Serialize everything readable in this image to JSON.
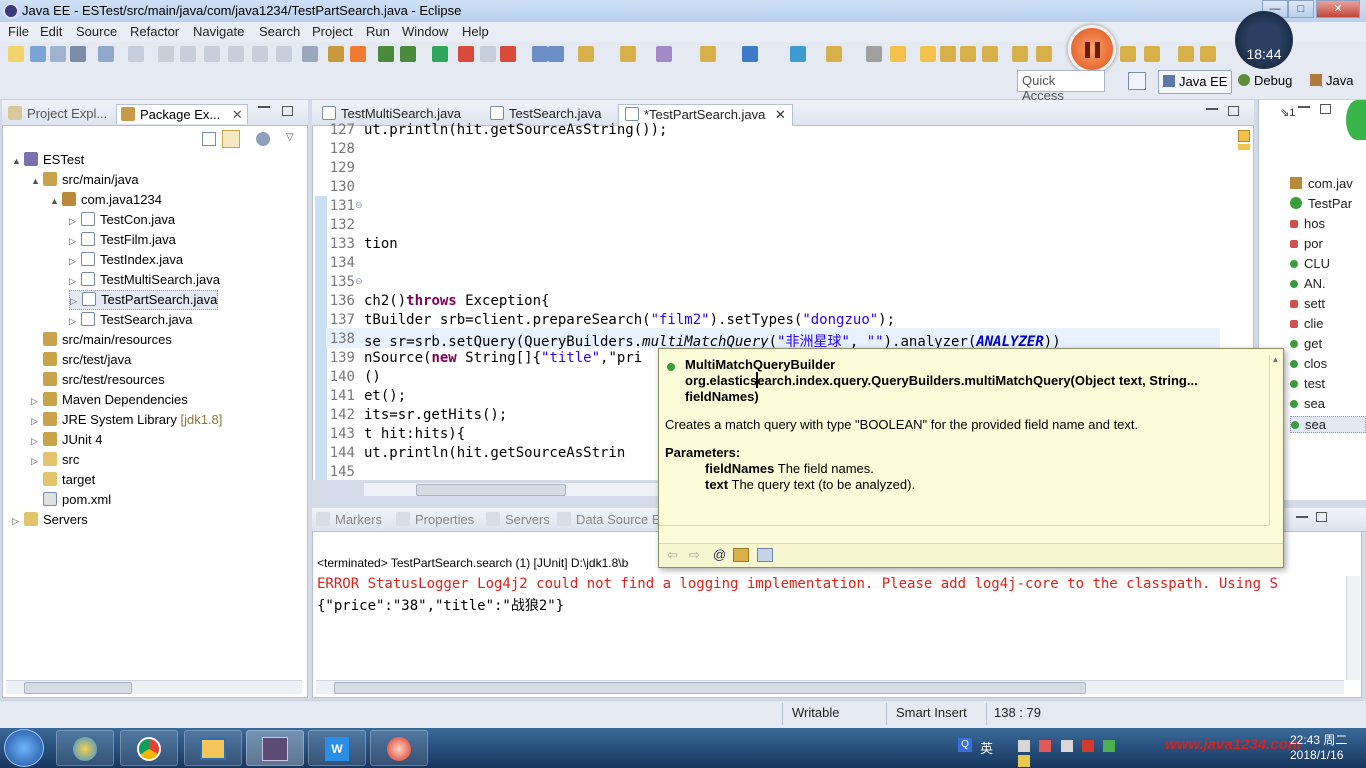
{
  "window": {
    "title": "Java EE - ESTest/src/main/java/com/java1234/TestPartSearch.java - Eclipse",
    "min_label": "—",
    "max_label": "□",
    "close_label": "✕"
  },
  "menu": [
    "File",
    "Edit",
    "Source",
    "Refactor",
    "Navigate",
    "Search",
    "Project",
    "Run",
    "Window",
    "Help"
  ],
  "toolbar": {
    "quick_access_placeholder": "Quick Access",
    "perspectives": [
      "Java EE",
      "Debug",
      "Java"
    ]
  },
  "recorder": {
    "clock": "18:44"
  },
  "left_panel": {
    "tabs": [
      "Project Expl...",
      "Package Ex..."
    ],
    "tree": [
      {
        "label": "ESTest",
        "level": 0,
        "twisty": "▲",
        "kind": "project"
      },
      {
        "label": "src/main/java",
        "level": 1,
        "twisty": "▲",
        "kind": "srcfolder"
      },
      {
        "label": "com.java1234",
        "level": 2,
        "twisty": "▲",
        "kind": "package"
      },
      {
        "label": "TestCon.java",
        "level": 3,
        "twisty": "▷",
        "kind": "java"
      },
      {
        "label": "TestFilm.java",
        "level": 3,
        "twisty": "▷",
        "kind": "java"
      },
      {
        "label": "TestIndex.java",
        "level": 3,
        "twisty": "▷",
        "kind": "java"
      },
      {
        "label": "TestMultiSearch.java",
        "level": 3,
        "twisty": "▷",
        "kind": "java"
      },
      {
        "label": "TestPartSearch.java",
        "level": 3,
        "twisty": "▷",
        "kind": "java",
        "selected": true
      },
      {
        "label": "TestSearch.java",
        "level": 3,
        "twisty": "▷",
        "kind": "java"
      },
      {
        "label": "src/main/resources",
        "level": 1,
        "twisty": "",
        "kind": "srcfolder"
      },
      {
        "label": "src/test/java",
        "level": 1,
        "twisty": "",
        "kind": "srcfolder"
      },
      {
        "label": "src/test/resources",
        "level": 1,
        "twisty": "",
        "kind": "srcfolder"
      },
      {
        "label": "Maven Dependencies",
        "level": 1,
        "twisty": "▷",
        "kind": "lib"
      },
      {
        "label": "JRE System Library",
        "decor": "[jdk1.8]",
        "level": 1,
        "twisty": "▷",
        "kind": "lib"
      },
      {
        "label": "JUnit 4",
        "level": 1,
        "twisty": "▷",
        "kind": "lib"
      },
      {
        "label": "src",
        "level": 1,
        "twisty": "▷",
        "kind": "folder"
      },
      {
        "label": "target",
        "level": 1,
        "twisty": "",
        "kind": "folder"
      },
      {
        "label": "pom.xml",
        "level": 1,
        "twisty": "",
        "kind": "xml"
      },
      {
        "label": "Servers",
        "level": 0,
        "twisty": "▷",
        "kind": "folder"
      }
    ]
  },
  "editor": {
    "tabs": [
      "TestMultiSearch.java",
      "TestSearch.java",
      "*TestPartSearch.java"
    ],
    "lines": [
      {
        "no": "127",
        "text": "ut.println(hit.getSourceAsString());"
      },
      {
        "no": "128",
        "text": ""
      },
      {
        "no": "129",
        "text": ""
      },
      {
        "no": "130",
        "text": ""
      },
      {
        "no": "131",
        "text": ""
      },
      {
        "no": "132",
        "text": ""
      },
      {
        "no": "133",
        "text": "tion"
      },
      {
        "no": "134",
        "text": ""
      },
      {
        "no": "135",
        "text": ""
      },
      {
        "no": "136",
        "text": "ch2()throws Exception{"
      },
      {
        "no": "137",
        "text": "tBuilder srb=client.prepareSearch(\"film2\").setTypes(\"dongzuo\");"
      },
      {
        "no": "138",
        "text": "se sr=srb.setQuery(QueryBuilders.multiMatchQuery(\"非洲星球\", \"\").analyzer(ANALYZER))"
      },
      {
        "no": "139",
        "text": "nSource(new String[]{\"title\",\"pri"
      },
      {
        "no": "140",
        "text": "()"
      },
      {
        "no": "141",
        "text": "et();"
      },
      {
        "no": "142",
        "text": "its=sr.getHits();"
      },
      {
        "no": "143",
        "text": "t hit:hits){"
      },
      {
        "no": "144",
        "text": "ut.println(hit.getSourceAsStrin"
      },
      {
        "no": "145",
        "text": ""
      }
    ]
  },
  "popup": {
    "signature": "MultiMatchQueryBuilder org.elasticsearch.index.query.QueryBuilders.multiMatchQuery(Object text, String... fieldNames)",
    "description": "Creates a match query with type \"BOOLEAN\" for the provided field name and text.",
    "params_title": "Parameters:",
    "params": [
      {
        "name": "fieldNames",
        "desc": "The field names."
      },
      {
        "name": "text",
        "desc": "The query text (to be analyzed)."
      }
    ]
  },
  "outline": {
    "items": [
      "com.jav",
      "TestPar",
      "hos",
      "por",
      "CLU",
      "AN.",
      "sett",
      "clie",
      "get",
      "clos",
      "test",
      "sea",
      "sea"
    ]
  },
  "console": {
    "tabs": [
      "Markers",
      "Properties",
      "Servers",
      "Data Source E"
    ],
    "terminated": "<terminated> TestPartSearch.search (1) [JUnit] D:\\jdk1.8\\b",
    "error": "ERROR StatusLogger Log4j2 could not find a logging implementation. Please add log4j-core to the classpath. Using S",
    "output": "{\"price\":\"38\",\"title\":\"战狼2\"}"
  },
  "status": {
    "writable": "Writable",
    "insert_mode": "Smart Insert",
    "position": "138 : 79"
  },
  "taskbar": {
    "ime": "英",
    "time": "22:43 周二",
    "date": "2018/1/16",
    "watermark": "www.java1234.com"
  }
}
